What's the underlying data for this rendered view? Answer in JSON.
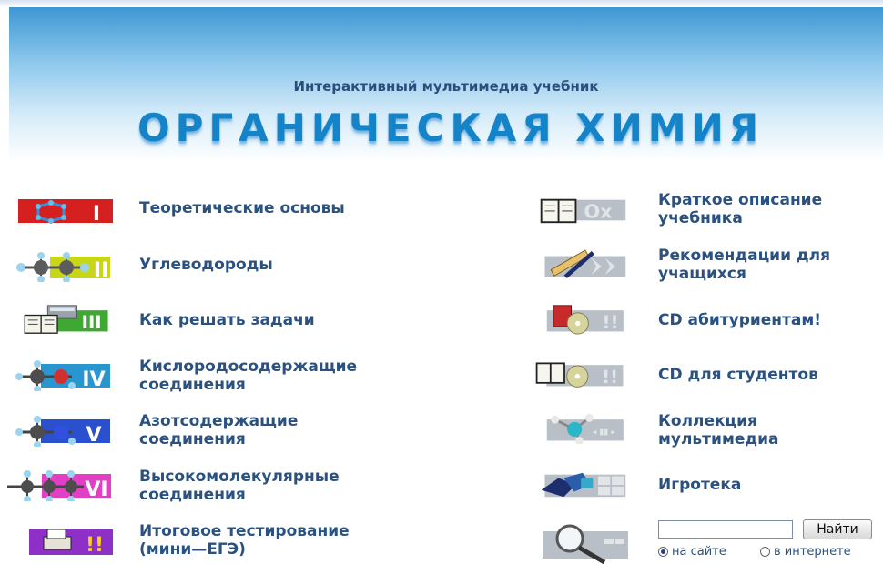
{
  "header": {
    "subtitle": "Интерактивный мультимедиа учебник",
    "title": "ОРГАНИЧЕСКАЯ ХИМИЯ"
  },
  "left_menu": [
    {
      "label_line1": "Теоретические основы",
      "label_line2": "",
      "roman": "I",
      "color": "#d61f1f",
      "icon": "ring-molecule-icon"
    },
    {
      "label_line1": "Углеводороды",
      "label_line2": "",
      "roman": "II",
      "color": "#c8d61a",
      "icon": "hydrocarbon-molecule-icon"
    },
    {
      "label_line1": "Как решать задачи",
      "label_line2": "",
      "roman": "III",
      "color": "#3fa832",
      "icon": "book-calculator-icon"
    },
    {
      "label_line1": "Кислородосодержащие",
      "label_line2": "соединения",
      "roman": "IV",
      "color": "#2a96d0",
      "icon": "oxygen-molecule-icon"
    },
    {
      "label_line1": "Азотсодержащие",
      "label_line2": "соединения",
      "roman": "V",
      "color": "#2a4fcf",
      "icon": "nitrogen-molecule-icon"
    },
    {
      "label_line1": "Высокомолекулярные",
      "label_line2": "соединения",
      "roman": "VI",
      "color": "#e23fc4",
      "icon": "polymer-molecule-icon"
    },
    {
      "label_line1": "Итоговое тестирование",
      "label_line2": "(мини—ЕГЭ)",
      "roman": "!!",
      "color": "#8e2fc8",
      "icon": "test-printer-icon"
    }
  ],
  "right_menu": [
    {
      "label_line1": "Краткое описание",
      "label_line2": "учебника",
      "icon": "book-ox-icon"
    },
    {
      "label_line1": "Рекомендации для",
      "label_line2": "учащихся",
      "icon": "ruler-pen-icon"
    },
    {
      "label_line1": "CD абитуриентам!",
      "label_line2": "",
      "icon": "cd-abiturient-icon"
    },
    {
      "label_line1": "CD для студентов",
      "label_line2": "",
      "icon": "cd-student-icon"
    },
    {
      "label_line1": "Коллекция",
      "label_line2": "мультимедиа",
      "icon": "multimedia-molecule-icon"
    },
    {
      "label_line1": "Игротека",
      "label_line2": "",
      "icon": "puzzle-icon"
    }
  ],
  "search": {
    "value": "",
    "button_label": "Найти",
    "option_site": "на сайте",
    "option_internet": "в интернете",
    "selected": "на сайте",
    "icon": "magnifier-icon"
  },
  "colors": {
    "title": "#1483c8",
    "label": "#2a5180",
    "panel_gray": "#b9bfc6"
  }
}
